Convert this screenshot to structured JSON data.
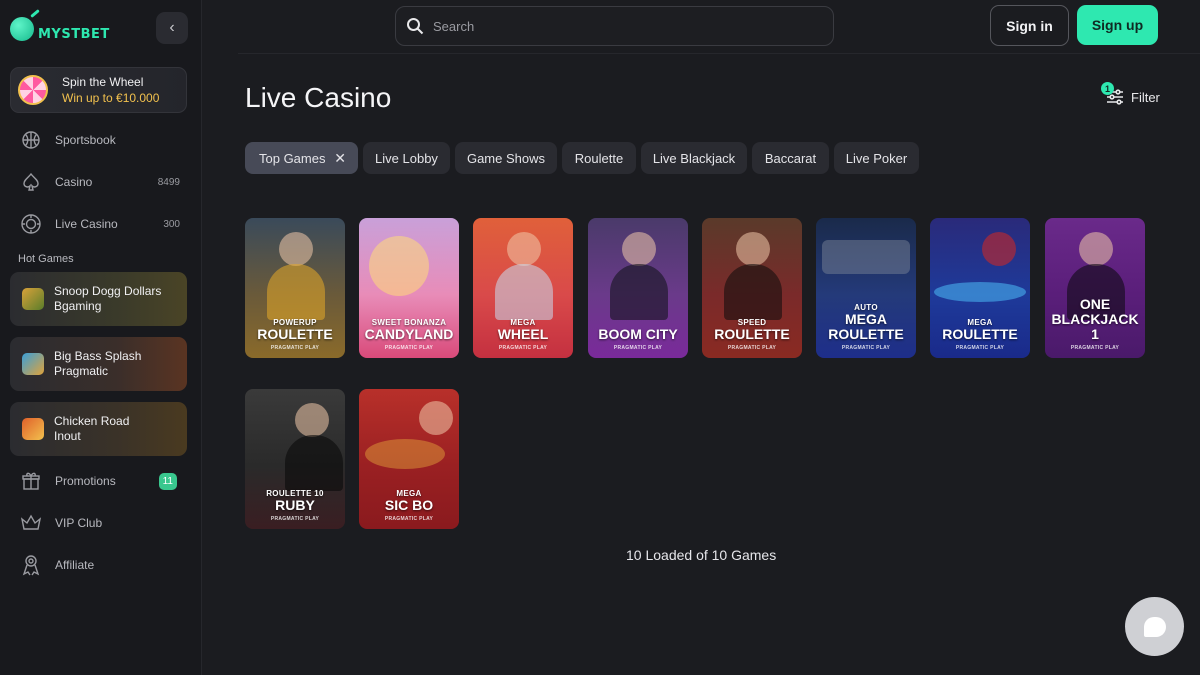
{
  "brand": {
    "logo_text": "MYSTBET"
  },
  "sidebar": {
    "spin": {
      "title": "Spin the Wheel",
      "subtitle": "Win up to €10.000"
    },
    "nav": [
      {
        "label": "Sportsbook",
        "icon": "basketball-icon",
        "count": ""
      },
      {
        "label": "Casino",
        "icon": "spade-icon",
        "count": "8499"
      },
      {
        "label": "Live Casino",
        "icon": "chip-icon",
        "count": "300"
      }
    ],
    "hot_label": "Hot Games",
    "hot_games": [
      {
        "title": "Snoop Dogg Dollars",
        "provider": "Bgaming"
      },
      {
        "title": "Big Bass Splash",
        "provider": "Pragmatic"
      },
      {
        "title": "Chicken Road",
        "provider": "Inout"
      }
    ],
    "footer_nav": [
      {
        "label": "Promotions",
        "icon": "gift-icon",
        "badge": "11"
      },
      {
        "label": "VIP Club",
        "icon": "crown-icon",
        "badge": ""
      },
      {
        "label": "Affiliate",
        "icon": "affiliate-icon",
        "badge": ""
      }
    ]
  },
  "header": {
    "search_placeholder": "Search",
    "signin_label": "Sign in",
    "signup_label": "Sign up"
  },
  "page": {
    "title": "Live Casino",
    "filter_label": "Filter",
    "filter_count": "1",
    "categories": [
      "Top Games",
      "Live Lobby",
      "Game Shows",
      "Roulette",
      "Live Blackjack",
      "Baccarat",
      "Live Poker"
    ],
    "games": [
      {
        "top": "POWERUP",
        "main": "ROULETTE",
        "provider": "PRAGMATIC PLAY"
      },
      {
        "top": "SWEET BONANZA",
        "main": "CANDYLAND",
        "provider": "PRAGMATIC PLAY"
      },
      {
        "top": "MEGA",
        "main": "WHEEL",
        "provider": "PRAGMATIC PLAY"
      },
      {
        "top": "",
        "main": "BOOM CITY",
        "provider": "PRAGMATIC PLAY"
      },
      {
        "top": "SPEED",
        "main": "ROULETTE",
        "provider": "PRAGMATIC PLAY"
      },
      {
        "top": "AUTO",
        "main": "MEGA ROULETTE",
        "provider": "PRAGMATIC PLAY"
      },
      {
        "top": "MEGA",
        "main": "ROULETTE",
        "provider": "PRAGMATIC PLAY"
      },
      {
        "top": "",
        "main": "ONE BLACKJACK 1",
        "provider": "PRAGMATIC PLAY"
      },
      {
        "top": "ROULETTE 10",
        "main": "RUBY",
        "provider": "PRAGMATIC PLAY"
      },
      {
        "top": "MEGA",
        "main": "SIC BO",
        "provider": "PRAGMATIC PLAY"
      }
    ],
    "loaded_text": "10 Loaded of 10 Games"
  },
  "colors": {
    "accent": "#2ee8b0",
    "background": "#1b1c20",
    "gold": "#f2c14e"
  }
}
